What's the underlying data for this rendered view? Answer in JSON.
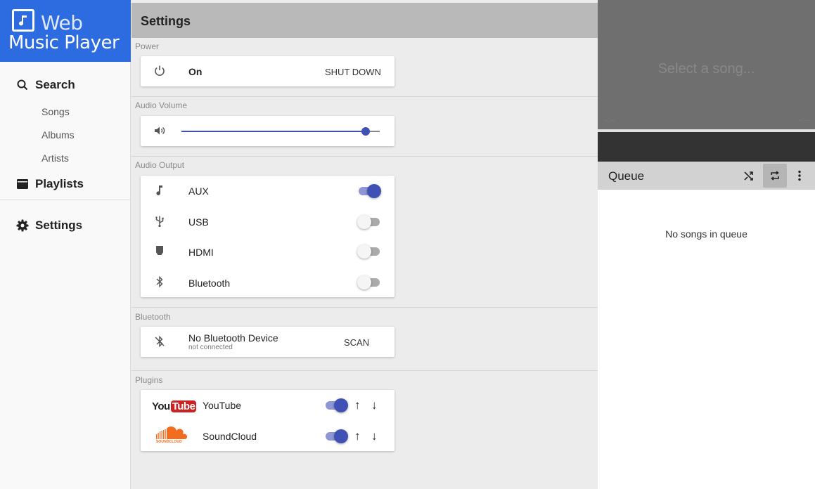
{
  "app": {
    "logo_line1": "Web",
    "logo_line2": "Music Player",
    "accent_color": "#2c6ce0",
    "toggle_on_color": "#3f51b5"
  },
  "sidebar": {
    "search": {
      "label": "Search",
      "icon": "search-icon"
    },
    "search_items": [
      "Songs",
      "Albums",
      "Artists"
    ],
    "playlists": {
      "label": "Playlists",
      "icon": "playlist-icon"
    },
    "settings": {
      "label": "Settings",
      "icon": "gear-icon"
    }
  },
  "settings": {
    "title": "Settings",
    "power": {
      "section": "Power",
      "status": "On",
      "button": "SHUT DOWN",
      "icon": "power-icon"
    },
    "volume": {
      "section": "Audio Volume",
      "value_fraction": 0.93,
      "icon": "volume-icon"
    },
    "output": {
      "section": "Audio Output",
      "items": [
        {
          "label": "AUX",
          "icon": "music-note-icon",
          "enabled": true
        },
        {
          "label": "USB",
          "icon": "usb-icon",
          "enabled": false
        },
        {
          "label": "HDMI",
          "icon": "hdmi-icon",
          "enabled": false
        },
        {
          "label": "Bluetooth",
          "icon": "bluetooth-icon",
          "enabled": false
        }
      ]
    },
    "bluetooth": {
      "section": "Bluetooth",
      "device": "No Bluetooth Device",
      "status": "not connected",
      "button": "SCAN",
      "icon": "bluetooth-disabled-icon"
    },
    "plugins": {
      "section": "Plugins",
      "items": [
        {
          "label": "YouTube",
          "logo_text_1": "You",
          "logo_text_2": "Tube",
          "enabled": true
        },
        {
          "label": "SoundCloud",
          "logo_text": "SOUNDCLOUD",
          "enabled": true
        }
      ],
      "up_arrow": "↑",
      "down_arrow": "↓"
    }
  },
  "player": {
    "placeholder": "Select a song...",
    "time_left": "--:--",
    "time_right": "--:--"
  },
  "queue": {
    "title": "Queue",
    "empty_text": "No songs in queue",
    "shuffle_active": false,
    "repeat_active": true
  }
}
